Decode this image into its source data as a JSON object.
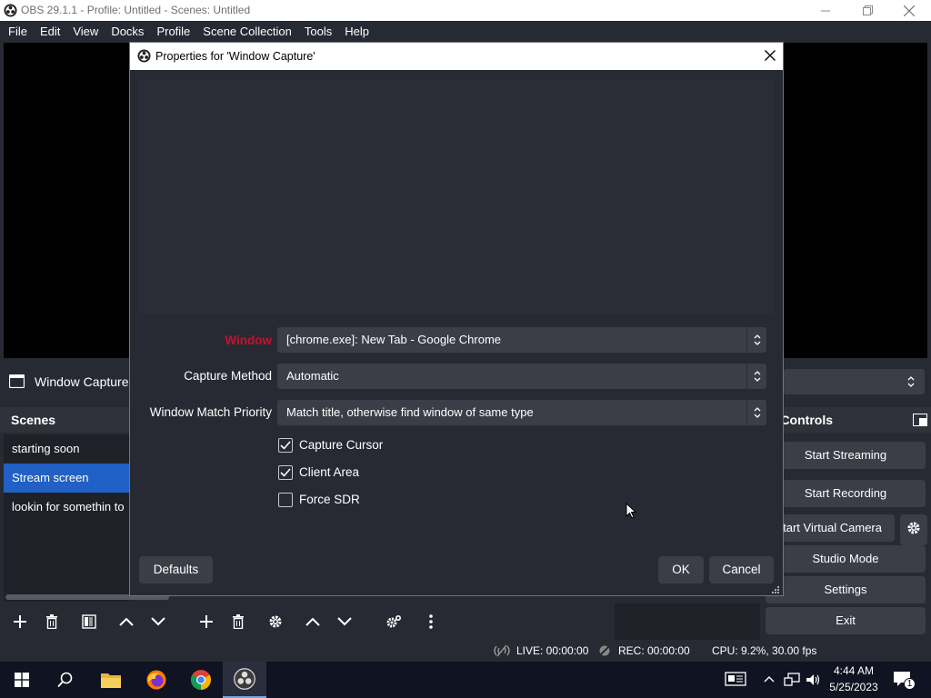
{
  "app": {
    "title": "OBS 29.1.1 - Profile: Untitled - Scenes: Untitled",
    "icon": "obs-logo-icon"
  },
  "menu": [
    "File",
    "Edit",
    "View",
    "Docks",
    "Profile",
    "Scene Collection",
    "Tools",
    "Help"
  ],
  "sourcebar": {
    "source_name": "Window Capture"
  },
  "scenes": {
    "title": "Scenes",
    "items": [
      {
        "label": "starting soon",
        "selected": false
      },
      {
        "label": "Stream screen",
        "selected": true
      },
      {
        "label": "lookin for somethin to",
        "selected": false
      }
    ]
  },
  "controls": {
    "title": "Controls",
    "start_streaming": "Start Streaming",
    "start_recording": "Start Recording",
    "start_virtual_camera": "Start Virtual Camera",
    "studio_mode": "Studio Mode",
    "settings": "Settings",
    "exit": "Exit"
  },
  "status": {
    "live": "LIVE: 00:00:00",
    "rec": "REC: 00:00:00",
    "cpu": "CPU: 9.2%, 30.00 fps"
  },
  "dialog": {
    "title": "Properties for 'Window Capture'",
    "window_label": "Window",
    "window_value": "[chrome.exe]: New Tab - Google Chrome",
    "capture_method_label": "Capture Method",
    "capture_method_value": "Automatic",
    "match_priority_label": "Window Match Priority",
    "match_priority_value": "Match title, otherwise find window of same type",
    "capture_cursor_label": "Capture Cursor",
    "capture_cursor_checked": true,
    "client_area_label": "Client Area",
    "client_area_checked": true,
    "force_sdr_label": "Force SDR",
    "force_sdr_checked": false,
    "defaults": "Defaults",
    "ok": "OK",
    "cancel": "Cancel"
  },
  "taskbar": {
    "time": "4:44 AM",
    "date": "5/25/2023",
    "notification_count": "1"
  },
  "colors": {
    "window_label_red": "#c8102e",
    "selected_scene": "#2160c4",
    "panel_bg": "#272a33"
  }
}
